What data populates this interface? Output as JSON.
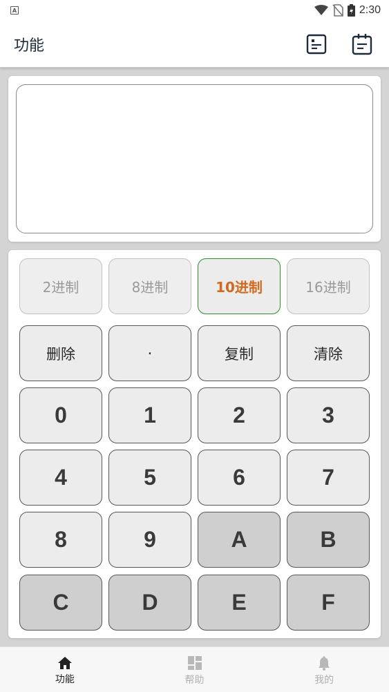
{
  "status_bar": {
    "left_icon_letter": "A",
    "time": "2:30",
    "icons": [
      "app-notification-icon",
      "wifi-icon",
      "no-sim-icon",
      "battery-charging-icon"
    ]
  },
  "app_bar": {
    "title": "功能",
    "actions": [
      "list-document-icon",
      "notepad-icon"
    ]
  },
  "display": {
    "value": ""
  },
  "base_row": [
    {
      "label": "2进制",
      "active": false
    },
    {
      "label": "8进制",
      "active": false
    },
    {
      "label": "10进制",
      "active": true
    },
    {
      "label": "16进制",
      "active": false
    }
  ],
  "func_row": [
    {
      "label": "删除"
    },
    {
      "label": "·"
    },
    {
      "label": "复制"
    },
    {
      "label": "清除"
    }
  ],
  "digits": [
    "0",
    "1",
    "2",
    "3",
    "4",
    "5",
    "6",
    "7",
    "8",
    "9",
    "A",
    "B",
    "C",
    "D",
    "E",
    "F"
  ],
  "colors": {
    "active_text": "#d2691e",
    "active_border": "#2e8b2e",
    "hex_key_bg": "#cfcfcf"
  },
  "bottom_nav": [
    {
      "label": "功能",
      "icon": "home-icon",
      "active": true
    },
    {
      "label": "帮助",
      "icon": "dashboard-icon",
      "active": false
    },
    {
      "label": "我的",
      "icon": "bell-icon",
      "active": false
    }
  ]
}
